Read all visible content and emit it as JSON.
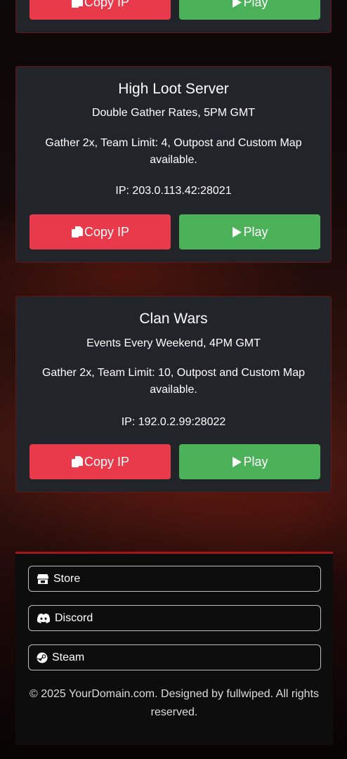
{
  "servers": [
    {
      "name": "",
      "subtitle": "",
      "description": "",
      "ip": "",
      "copy_label": "Copy IP",
      "play_label": "Play"
    },
    {
      "name": "High Loot Server",
      "subtitle": "Double Gather Rates, 5PM GMT",
      "description": "Gather 2x, Team Limit: 4, Outpost and Custom Map available.",
      "ip": "IP: 203.0.113.42:28021",
      "copy_label": "Copy IP",
      "play_label": "Play"
    },
    {
      "name": "Clan Wars",
      "subtitle": "Events Every Weekend, 4PM GMT",
      "description": "Gather 2x, Team Limit: 10, Outpost and Custom Map available.",
      "ip": "IP: 192.0.2.99:28022",
      "copy_label": "Copy IP",
      "play_label": "Play"
    }
  ],
  "footer": {
    "links": [
      {
        "label": "Store",
        "icon": "store-icon"
      },
      {
        "label": "Discord",
        "icon": "discord-icon"
      },
      {
        "label": "Steam",
        "icon": "steam-icon"
      }
    ],
    "copyright": "© 2025 YourDomain.com. Designed by fullwiped. All rights reserved."
  },
  "colors": {
    "copy_button": "#e83a4a",
    "play_button": "#4cb25a",
    "card_border": "#6b1216",
    "footer_accent": "#a3151b"
  }
}
